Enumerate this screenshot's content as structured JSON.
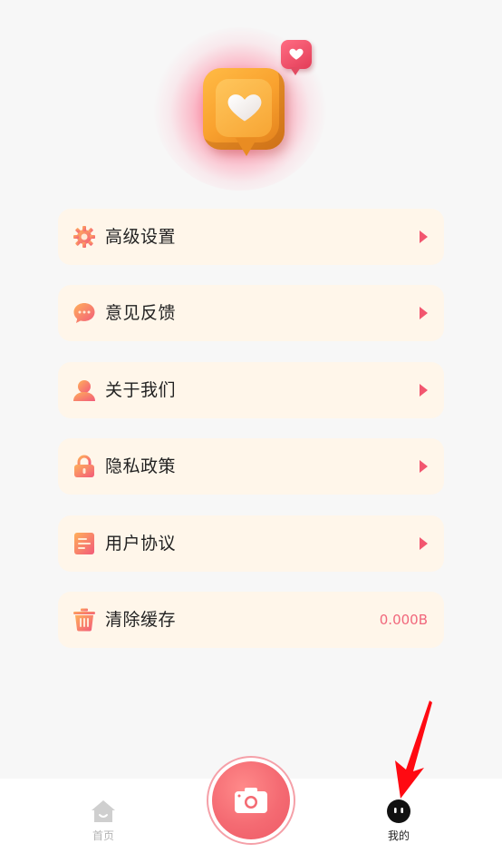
{
  "theme": {
    "accent": "#f2566f",
    "card_bg": "#fff6ea",
    "page_bg": "#f7f7f7",
    "icon_gradient": [
      "#ffb05a",
      "#f25a7a"
    ]
  },
  "hero": {
    "icon": "heart-chat-bubble-icon",
    "secondary_icon": "small-heart-bubble-icon"
  },
  "menu": {
    "items": [
      {
        "label": "高级设置",
        "icon": "gear-icon"
      },
      {
        "label": "意见反馈",
        "icon": "chat-bubble-icon"
      },
      {
        "label": "关于我们",
        "icon": "user-icon"
      },
      {
        "label": "隐私政策",
        "icon": "lock-icon"
      },
      {
        "label": "用户协议",
        "icon": "document-icon"
      },
      {
        "label": "清除缓存",
        "icon": "trash-icon",
        "value": "0.000B"
      }
    ]
  },
  "tabbar": {
    "home": {
      "label": "首页",
      "icon": "home-icon",
      "active": false
    },
    "camera": {
      "icon": "camera-icon"
    },
    "mine": {
      "label": "我的",
      "icon": "profile-face-icon",
      "active": true
    }
  },
  "annotation": {
    "color": "#ff0a12",
    "icon": "red-arrow-pointer-icon"
  }
}
